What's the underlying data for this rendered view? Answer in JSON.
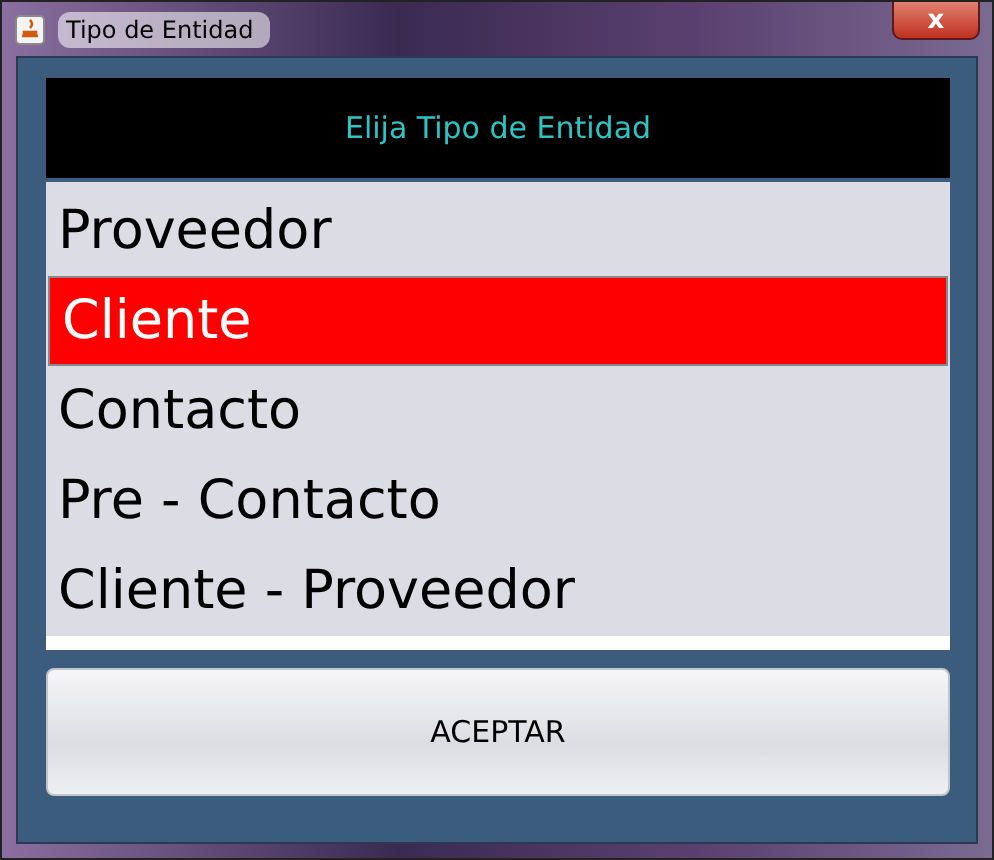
{
  "window": {
    "title": "Tipo de Entidad",
    "close": "x"
  },
  "header": "Elija Tipo de Entidad",
  "items": [
    {
      "label": "Proveedor",
      "selected": false
    },
    {
      "label": "Cliente",
      "selected": true
    },
    {
      "label": "Contacto",
      "selected": false
    },
    {
      "label": "Pre - Contacto",
      "selected": false
    },
    {
      "label": "Cliente - Proveedor",
      "selected": false
    }
  ],
  "button": "ACEPTAR"
}
